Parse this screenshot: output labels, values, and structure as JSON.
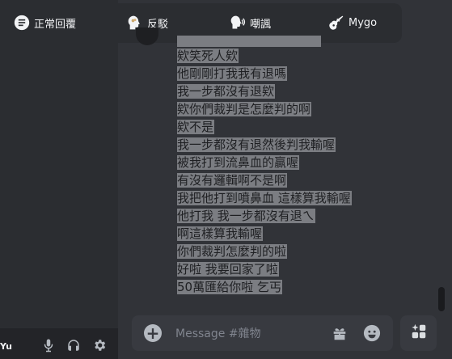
{
  "tabs": [
    {
      "label": "正常回覆",
      "icon": "menu-circle-icon"
    },
    {
      "label": "反駁",
      "icon": "head-brain-icon"
    },
    {
      "label": "嘲諷",
      "icon": "head-speaking-icon"
    },
    {
      "label": "Mygo",
      "icon": "guitar-icon"
    }
  ],
  "messages": [
    "欸笑死人欸",
    "他剛剛打我我有退嗎",
    "我一步都沒有退欸",
    "欸你們裁判是怎麼判的啊",
    "欸不是",
    "我一步都沒有退然後判我輸喔",
    "被我打到流鼻血的贏喔",
    "有沒有邏輯啊不是啊",
    "我把他打到噴鼻血 這樣算我輸喔",
    "他打我 我一步都沒有退ㄟ",
    "啊這樣算我輸喔",
    "你們裁判怎麼判的啦",
    "好啦 我要回家了啦",
    "50萬匯給你啦 乞丐"
  ],
  "composer": {
    "placeholder": "Message #雜物"
  },
  "user_panel": {
    "name": "Yu"
  },
  "colors": {
    "background": "#313338",
    "sidebar": "#2b2d31",
    "selection": "#7b7d82"
  }
}
